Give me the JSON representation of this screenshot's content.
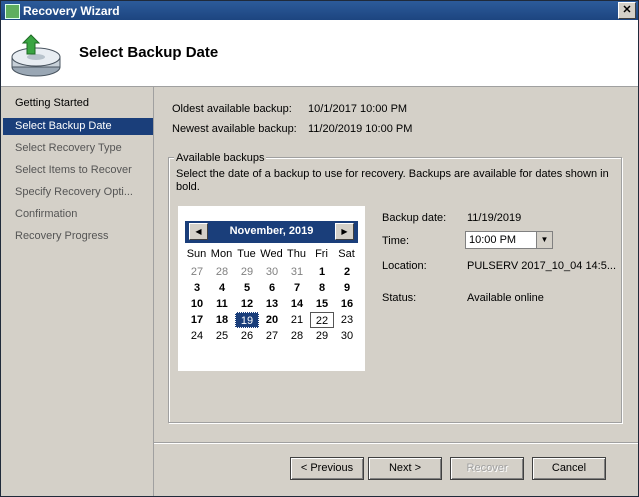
{
  "window": {
    "title": "Recovery Wizard",
    "close_glyph": "✕"
  },
  "header": {
    "title": "Select Backup Date",
    "icon": "backup-recovery-icon"
  },
  "sidebar": {
    "items": [
      {
        "label": "Getting Started",
        "state": "done"
      },
      {
        "label": "Select Backup Date",
        "state": "current"
      },
      {
        "label": "Select Recovery Type",
        "state": "pending"
      },
      {
        "label": "Select Items to Recover",
        "state": "pending"
      },
      {
        "label": "Specify Recovery Opti...",
        "state": "pending"
      },
      {
        "label": "Confirmation",
        "state": "pending"
      },
      {
        "label": "Recovery Progress",
        "state": "pending"
      }
    ]
  },
  "backup_range": {
    "oldest_label": "Oldest available backup:",
    "oldest_value": "10/1/2017 10:00 PM",
    "newest_label": "Newest available backup:",
    "newest_value": "11/20/2019 10:00 PM"
  },
  "available": {
    "group_title": "Available backups",
    "description": "Select the date of a backup to use for recovery. Backups are available for dates shown in bold."
  },
  "calendar": {
    "month_label": "November, 2019",
    "prev_glyph": "◀",
    "next_glyph": "▶",
    "weekdays": [
      "Sun",
      "Mon",
      "Tue",
      "Wed",
      "Thu",
      "Fri",
      "Sat"
    ],
    "weeks": [
      [
        {
          "d": "27",
          "t": "other"
        },
        {
          "d": "28",
          "t": "other"
        },
        {
          "d": "29",
          "t": "other"
        },
        {
          "d": "30",
          "t": "other"
        },
        {
          "d": "31",
          "t": "other"
        },
        {
          "d": "1",
          "t": "bold"
        },
        {
          "d": "2",
          "t": "bold"
        }
      ],
      [
        {
          "d": "3",
          "t": "bold"
        },
        {
          "d": "4",
          "t": "bold"
        },
        {
          "d": "5",
          "t": "bold"
        },
        {
          "d": "6",
          "t": "bold"
        },
        {
          "d": "7",
          "t": "bold"
        },
        {
          "d": "8",
          "t": "bold"
        },
        {
          "d": "9",
          "t": "bold"
        }
      ],
      [
        {
          "d": "10",
          "t": "bold"
        },
        {
          "d": "11",
          "t": "bold"
        },
        {
          "d": "12",
          "t": "bold"
        },
        {
          "d": "13",
          "t": "bold"
        },
        {
          "d": "14",
          "t": "bold"
        },
        {
          "d": "15",
          "t": "bold"
        },
        {
          "d": "16",
          "t": "bold"
        }
      ],
      [
        {
          "d": "17",
          "t": "bold"
        },
        {
          "d": "18",
          "t": "bold"
        },
        {
          "d": "19",
          "t": "selected"
        },
        {
          "d": "20",
          "t": "bold"
        },
        {
          "d": "21",
          "t": "normal"
        },
        {
          "d": "22",
          "t": "today"
        },
        {
          "d": "23",
          "t": "normal"
        }
      ],
      [
        {
          "d": "24",
          "t": "normal"
        },
        {
          "d": "25",
          "t": "normal"
        },
        {
          "d": "26",
          "t": "normal"
        },
        {
          "d": "27",
          "t": "normal"
        },
        {
          "d": "28",
          "t": "normal"
        },
        {
          "d": "29",
          "t": "normal"
        },
        {
          "d": "30",
          "t": "normal"
        }
      ]
    ]
  },
  "details": {
    "backup_date_label": "Backup date:",
    "backup_date_value": "11/19/2019",
    "time_label": "Time:",
    "time_value": "10:00 PM",
    "location_label": "Location:",
    "location_value": "PULSERV 2017_10_04 14:5...",
    "status_label": "Status:",
    "status_value": "Available online"
  },
  "buttons": {
    "previous": "< Previous",
    "next": "Next >",
    "recover": "Recover",
    "cancel": "Cancel"
  },
  "colors": {
    "accent": "#1a3e7a",
    "title_bar": "#2c5b9a",
    "face": "#d4d0c8"
  }
}
